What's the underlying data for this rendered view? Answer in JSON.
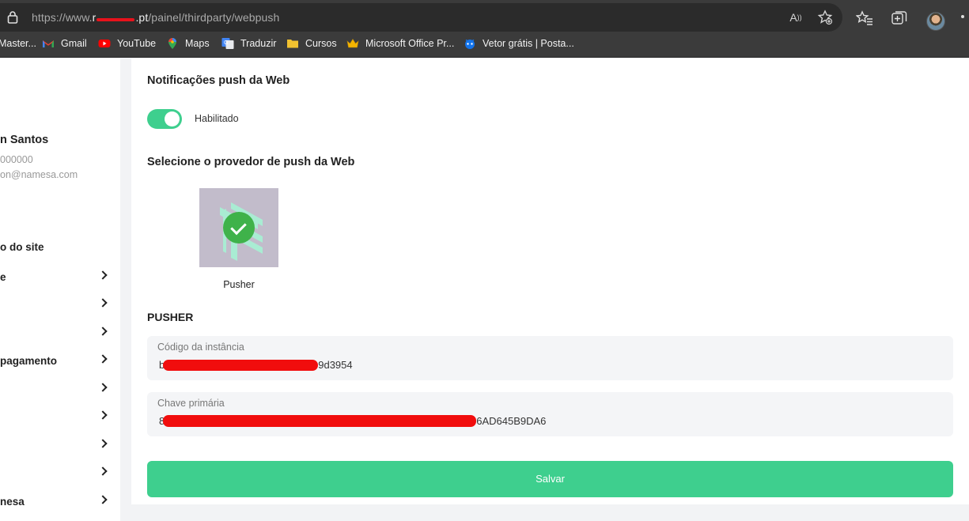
{
  "browser": {
    "url_prefix": "https://www.",
    "url_host_partial": "r",
    "url_suffix": ".pt",
    "url_path": "/painel/thirdparty/webpush",
    "bookmarks": [
      {
        "label": "Master...",
        "icon": "folder-icon"
      },
      {
        "label": "Gmail",
        "icon": "gmail-icon"
      },
      {
        "label": "YouTube",
        "icon": "youtube-icon"
      },
      {
        "label": "Maps",
        "icon": "maps-icon"
      },
      {
        "label": "Traduzir",
        "icon": "translate-icon"
      },
      {
        "label": "Cursos",
        "icon": "folder-icon"
      },
      {
        "label": "Microsoft Office Pr...",
        "icon": "crown-icon"
      },
      {
        "label": "Vetor grátis | Posta...",
        "icon": "freepik-icon"
      }
    ]
  },
  "sidebar": {
    "user_name": "n Santos",
    "user_phone": "000000",
    "user_email": "on@namesa.com",
    "section": "o do site",
    "items": [
      {
        "label": "e"
      },
      {
        "label": ""
      },
      {
        "label": ""
      },
      {
        "label": "pagamento"
      },
      {
        "label": ""
      },
      {
        "label": ""
      },
      {
        "label": ""
      },
      {
        "label": ""
      },
      {
        "label": "nesa"
      }
    ]
  },
  "main": {
    "title": "Notificações push da Web",
    "toggle_label": "Habilitado",
    "toggle_on": true,
    "provider_section": "Selecione o provedor de push da Web",
    "provider_name": "Pusher",
    "pusher_heading": "PUSHER",
    "fields": [
      {
        "label": "Código da instância",
        "value_start": "b",
        "value_end": "9d3954"
      },
      {
        "label": "Chave primária",
        "value_start": "8",
        "value_end": "6AD645B9DA6"
      }
    ],
    "save_label": "Salvar"
  },
  "colors": {
    "accent": "#3ecf8e",
    "check": "#3fb24a",
    "redaction": "#f10d0d",
    "provider_bg": "#c2bccb"
  }
}
